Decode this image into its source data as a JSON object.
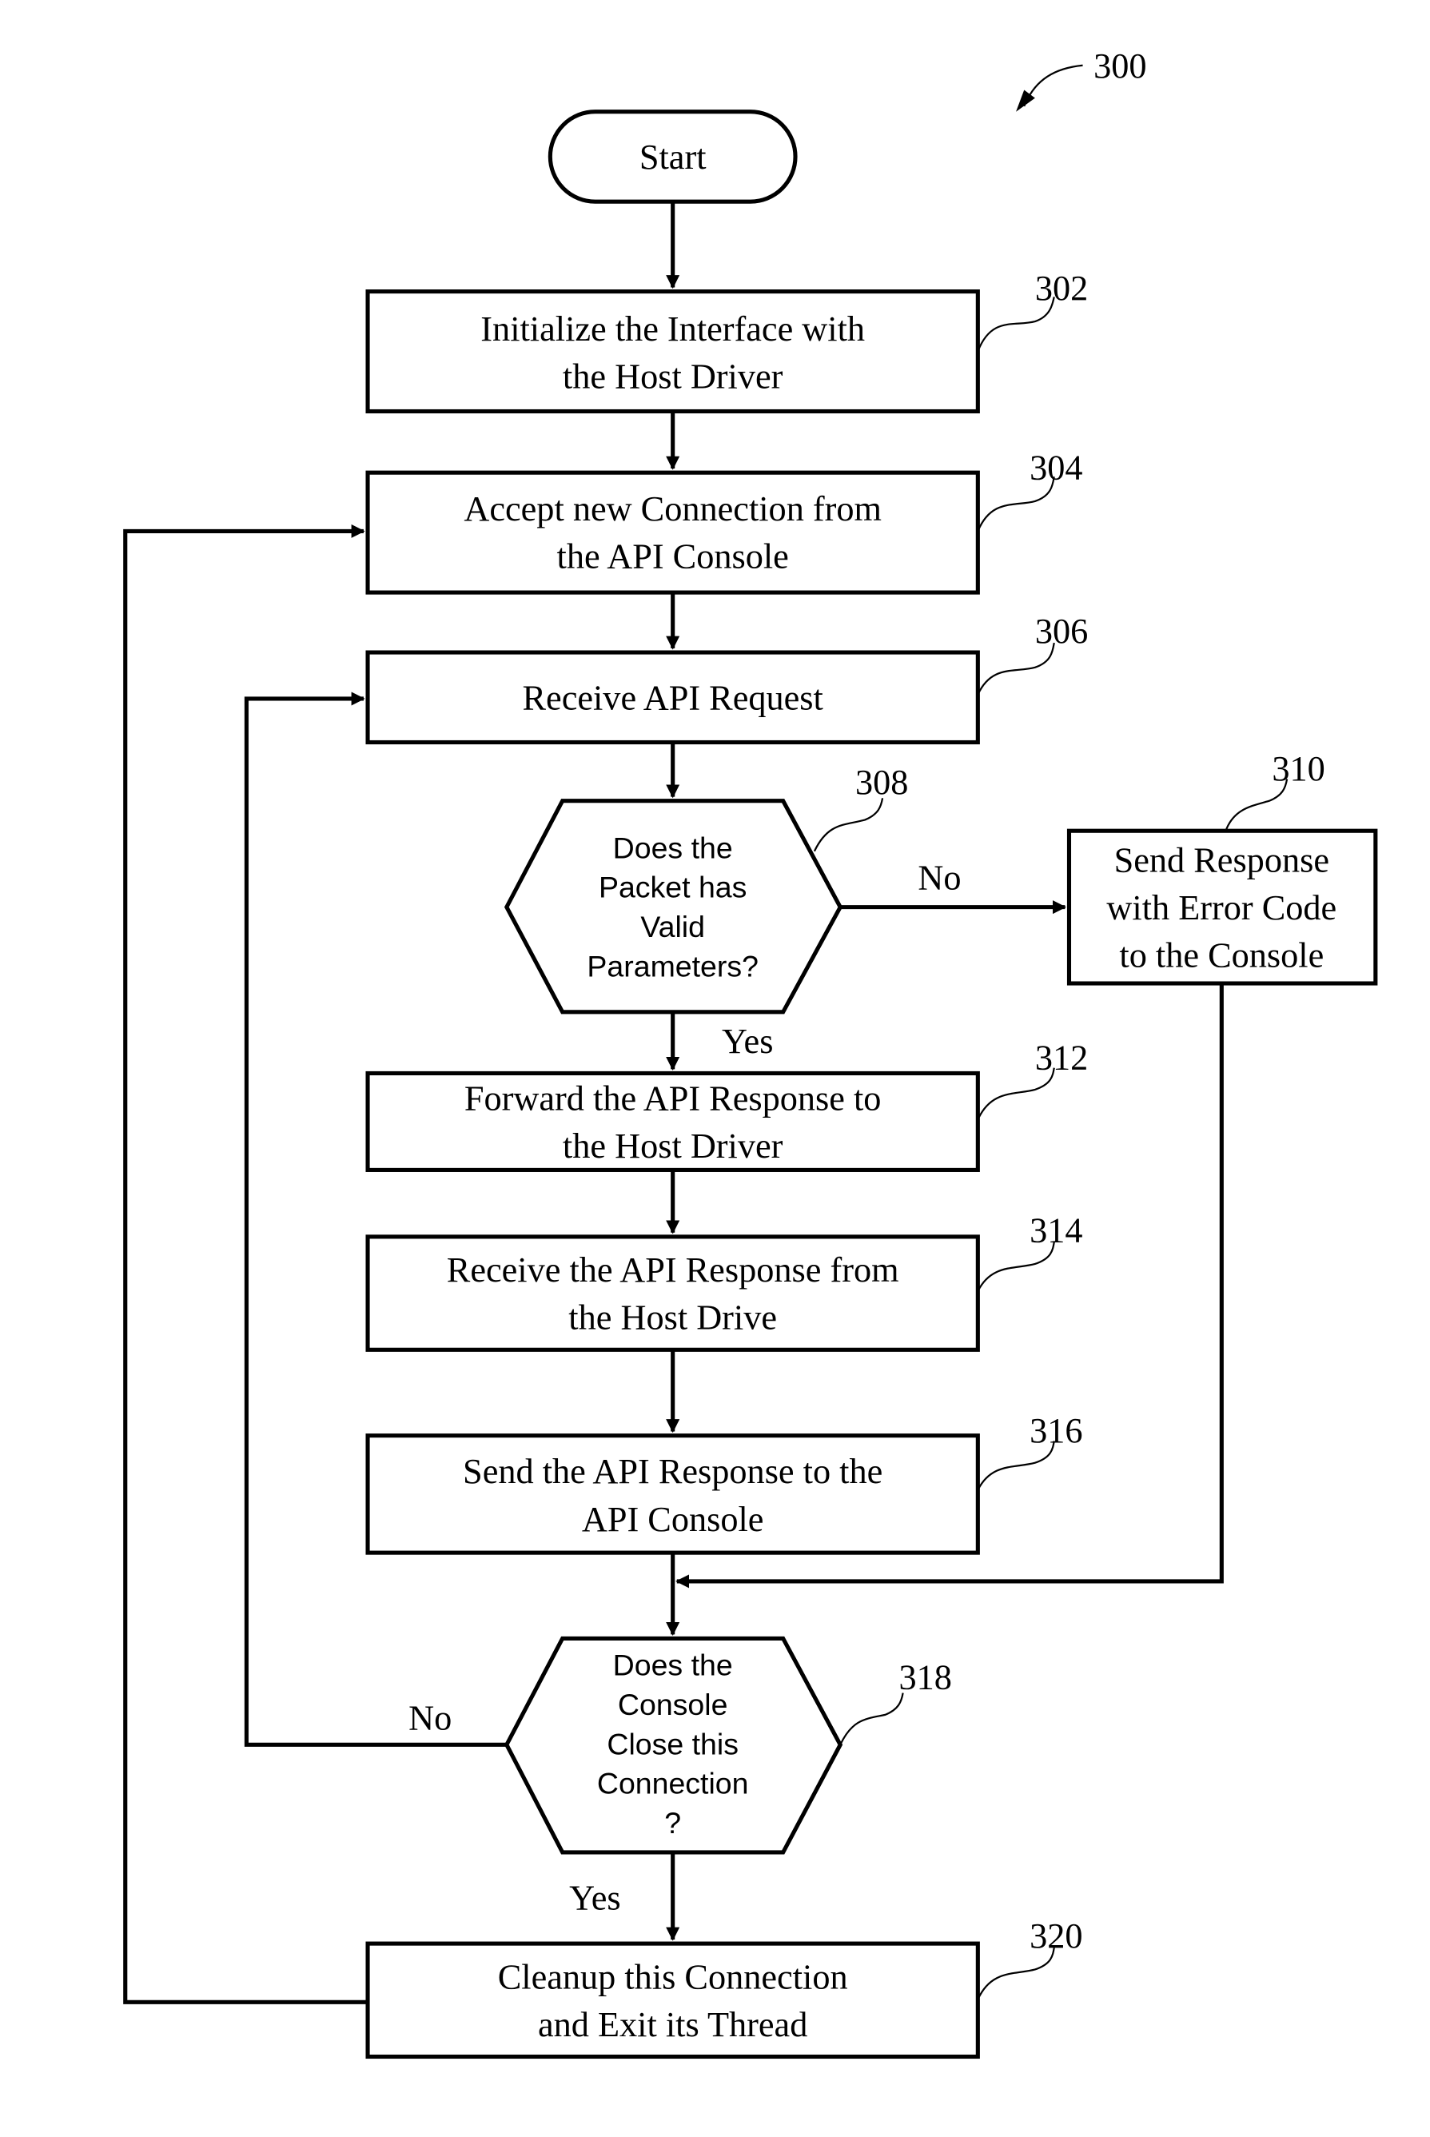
{
  "figure": {
    "reference": "300",
    "start_label": "Start",
    "steps": [
      {
        "id": "302",
        "lines": [
          "Initialize the Interface with",
          "the Host Driver"
        ]
      },
      {
        "id": "304",
        "lines": [
          "Accept new Connection from",
          "the API Console"
        ]
      },
      {
        "id": "306",
        "lines": [
          "Receive API Request"
        ]
      },
      {
        "id": "308",
        "type": "decision",
        "lines": [
          "Does the",
          "Packet has",
          "Valid",
          "Parameters?"
        ]
      },
      {
        "id": "310",
        "lines": [
          "Send Response",
          "with Error Code",
          "to the Console"
        ]
      },
      {
        "id": "312",
        "lines": [
          "Forward the API Response to",
          "the Host Driver"
        ]
      },
      {
        "id": "314",
        "lines": [
          "Receive the API Response from",
          "the Host Drive"
        ]
      },
      {
        "id": "316",
        "lines": [
          "Send the API Response to the",
          "API Console"
        ]
      },
      {
        "id": "318",
        "type": "decision",
        "lines": [
          "Does the",
          "Console",
          "Close this",
          "Connection",
          "?"
        ]
      },
      {
        "id": "320",
        "lines": [
          "Cleanup this Connection",
          "and Exit its Thread"
        ]
      }
    ],
    "edge_labels": {
      "d308_no": "No",
      "d308_yes": "Yes",
      "d318_no": "No",
      "d318_yes": "Yes"
    }
  }
}
